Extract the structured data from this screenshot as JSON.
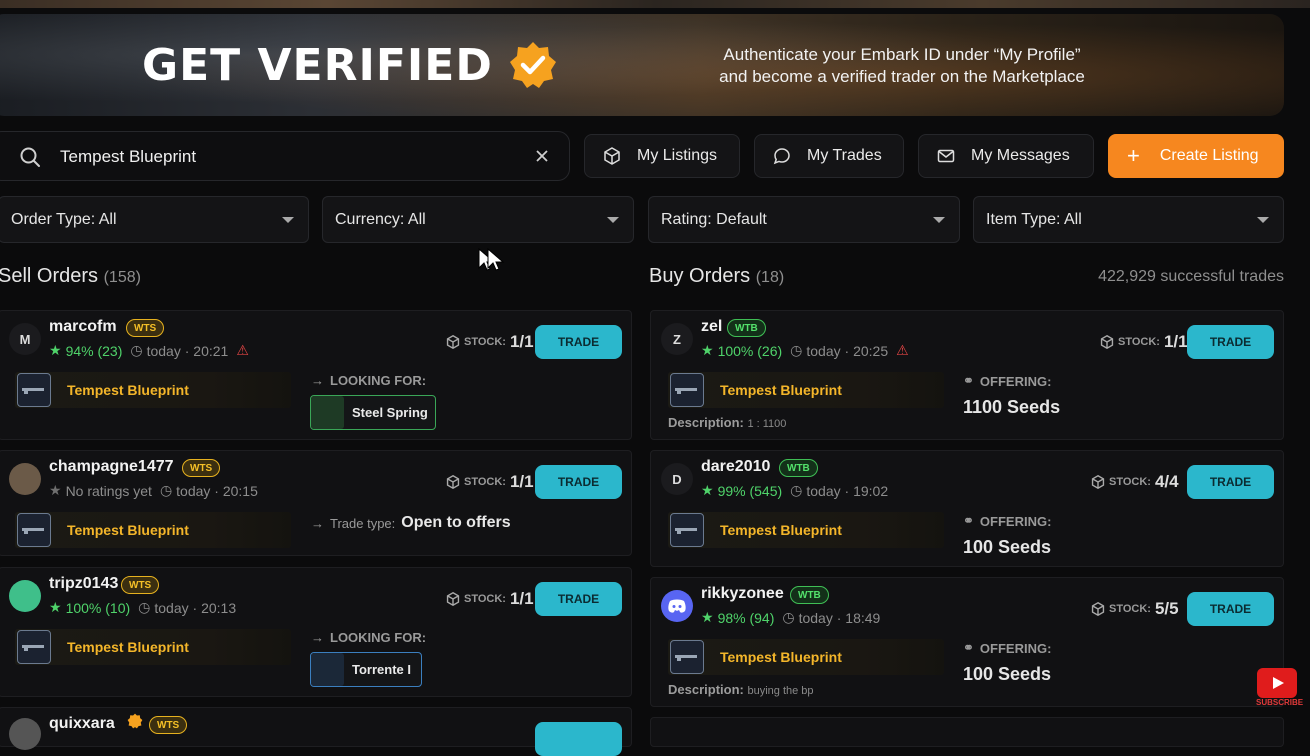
{
  "banner": {
    "title": "GET VERIFIED",
    "subtitle_line1": "Authenticate your Embark ID under “My Profile”",
    "subtitle_line2": "and become a verified trader on the Marketplace"
  },
  "search": {
    "value": "Tempest Blueprint",
    "icon": "search-icon"
  },
  "nav": {
    "my_listings": "My Listings",
    "my_trades": "My Trades",
    "my_messages": "My Messages",
    "create_listing": "Create Listing",
    "create_plus": "+"
  },
  "filters": {
    "order_type": "Order Type: All",
    "currency": "Currency: All",
    "rating": "Rating: Default",
    "item_type": "Item Type: All"
  },
  "sell": {
    "title": "Sell Orders",
    "count": "(158)"
  },
  "buy": {
    "title": "Buy Orders",
    "count": "(18)"
  },
  "successful_trades": "422,929 successful trades",
  "labels": {
    "stock": "STOCK:",
    "trade": "TRADE",
    "looking_for": "LOOKING FOR:",
    "offering": "OFFERING:",
    "description": "Description:",
    "trade_type": "Trade type:"
  },
  "sell_orders": [
    {
      "initial": "M",
      "user": "marcofm",
      "tag": "WTS",
      "rating": "94% (23)",
      "time": "today · 20:21",
      "stock": "1/1",
      "item": "Tempest Blueprint",
      "looking": "Steel Spring"
    },
    {
      "initial": "",
      "user": "champagne1477",
      "tag": "WTS",
      "rating": "No ratings yet",
      "time": "today · 20:15",
      "stock": "1/1",
      "item": "Tempest Blueprint",
      "trade_type_value": "Open to offers"
    },
    {
      "initial": "",
      "user": "tripz0143",
      "tag": "WTS",
      "rating": "100% (10)",
      "time": "today · 20:13",
      "stock": "1/1",
      "item": "Tempest Blueprint",
      "looking": "Torrente I"
    },
    {
      "user": "quixxara",
      "tag": "WTS"
    }
  ],
  "buy_orders": [
    {
      "initial": "Z",
      "user": "zel",
      "tag": "WTB",
      "rating": "100% (26)",
      "time": "today · 20:25",
      "stock": "1/1",
      "item": "Tempest Blueprint",
      "offering": "1100 Seeds",
      "description": "1 : 1100"
    },
    {
      "initial": "D",
      "user": "dare2010",
      "tag": "WTB",
      "rating": "99% (545)",
      "time": "today · 19:02",
      "stock": "4/4",
      "item": "Tempest Blueprint",
      "offering": "100 Seeds"
    },
    {
      "initial": "",
      "user": "rikkyzonee",
      "tag": "WTB",
      "rating": "98% (94)",
      "time": "today · 18:49",
      "stock": "5/5",
      "item": "Tempest Blueprint",
      "offering": "100 Seeds",
      "description": "buying the bp"
    }
  ],
  "youtube": {
    "label": "SUBSCRIBE"
  },
  "colors": {
    "accent": "#f6871f",
    "trade": "#2bb7cc",
    "wts": "#f5c027",
    "wtb": "#53e06b",
    "item": "#f4b62a"
  }
}
